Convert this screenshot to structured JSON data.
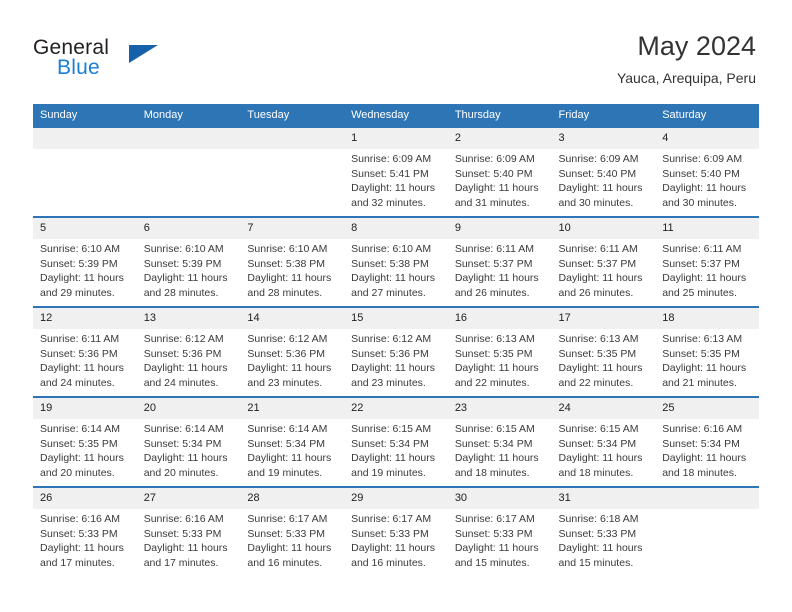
{
  "brand": {
    "word1": "General",
    "word2": "Blue",
    "logo_icon": "triangle-logo-icon",
    "color_primary": "#1562ab",
    "color_secondary": "#1b7fd4"
  },
  "header": {
    "month_title": "May 2024",
    "location": "Yauca, Arequipa, Peru"
  },
  "theme": {
    "header_row_color": "#2e75b6",
    "daynum_band_color": "#f0f0f0",
    "text_color": "#3a3a3a"
  },
  "calendar": {
    "weekday_headers": [
      "Sunday",
      "Monday",
      "Tuesday",
      "Wednesday",
      "Thursday",
      "Friday",
      "Saturday"
    ],
    "weeks": [
      [
        {
          "day": "",
          "sunrise": "",
          "sunset": "",
          "daylight_line1": "",
          "daylight_line2": ""
        },
        {
          "day": "",
          "sunrise": "",
          "sunset": "",
          "daylight_line1": "",
          "daylight_line2": ""
        },
        {
          "day": "",
          "sunrise": "",
          "sunset": "",
          "daylight_line1": "",
          "daylight_line2": ""
        },
        {
          "day": "1",
          "sunrise": "Sunrise: 6:09 AM",
          "sunset": "Sunset: 5:41 PM",
          "daylight_line1": "Daylight: 11 hours",
          "daylight_line2": "and 32 minutes."
        },
        {
          "day": "2",
          "sunrise": "Sunrise: 6:09 AM",
          "sunset": "Sunset: 5:40 PM",
          "daylight_line1": "Daylight: 11 hours",
          "daylight_line2": "and 31 minutes."
        },
        {
          "day": "3",
          "sunrise": "Sunrise: 6:09 AM",
          "sunset": "Sunset: 5:40 PM",
          "daylight_line1": "Daylight: 11 hours",
          "daylight_line2": "and 30 minutes."
        },
        {
          "day": "4",
          "sunrise": "Sunrise: 6:09 AM",
          "sunset": "Sunset: 5:40 PM",
          "daylight_line1": "Daylight: 11 hours",
          "daylight_line2": "and 30 minutes."
        }
      ],
      [
        {
          "day": "5",
          "sunrise": "Sunrise: 6:10 AM",
          "sunset": "Sunset: 5:39 PM",
          "daylight_line1": "Daylight: 11 hours",
          "daylight_line2": "and 29 minutes."
        },
        {
          "day": "6",
          "sunrise": "Sunrise: 6:10 AM",
          "sunset": "Sunset: 5:39 PM",
          "daylight_line1": "Daylight: 11 hours",
          "daylight_line2": "and 28 minutes."
        },
        {
          "day": "7",
          "sunrise": "Sunrise: 6:10 AM",
          "sunset": "Sunset: 5:38 PM",
          "daylight_line1": "Daylight: 11 hours",
          "daylight_line2": "and 28 minutes."
        },
        {
          "day": "8",
          "sunrise": "Sunrise: 6:10 AM",
          "sunset": "Sunset: 5:38 PM",
          "daylight_line1": "Daylight: 11 hours",
          "daylight_line2": "and 27 minutes."
        },
        {
          "day": "9",
          "sunrise": "Sunrise: 6:11 AM",
          "sunset": "Sunset: 5:37 PM",
          "daylight_line1": "Daylight: 11 hours",
          "daylight_line2": "and 26 minutes."
        },
        {
          "day": "10",
          "sunrise": "Sunrise: 6:11 AM",
          "sunset": "Sunset: 5:37 PM",
          "daylight_line1": "Daylight: 11 hours",
          "daylight_line2": "and 26 minutes."
        },
        {
          "day": "11",
          "sunrise": "Sunrise: 6:11 AM",
          "sunset": "Sunset: 5:37 PM",
          "daylight_line1": "Daylight: 11 hours",
          "daylight_line2": "and 25 minutes."
        }
      ],
      [
        {
          "day": "12",
          "sunrise": "Sunrise: 6:11 AM",
          "sunset": "Sunset: 5:36 PM",
          "daylight_line1": "Daylight: 11 hours",
          "daylight_line2": "and 24 minutes."
        },
        {
          "day": "13",
          "sunrise": "Sunrise: 6:12 AM",
          "sunset": "Sunset: 5:36 PM",
          "daylight_line1": "Daylight: 11 hours",
          "daylight_line2": "and 24 minutes."
        },
        {
          "day": "14",
          "sunrise": "Sunrise: 6:12 AM",
          "sunset": "Sunset: 5:36 PM",
          "daylight_line1": "Daylight: 11 hours",
          "daylight_line2": "and 23 minutes."
        },
        {
          "day": "15",
          "sunrise": "Sunrise: 6:12 AM",
          "sunset": "Sunset: 5:36 PM",
          "daylight_line1": "Daylight: 11 hours",
          "daylight_line2": "and 23 minutes."
        },
        {
          "day": "16",
          "sunrise": "Sunrise: 6:13 AM",
          "sunset": "Sunset: 5:35 PM",
          "daylight_line1": "Daylight: 11 hours",
          "daylight_line2": "and 22 minutes."
        },
        {
          "day": "17",
          "sunrise": "Sunrise: 6:13 AM",
          "sunset": "Sunset: 5:35 PM",
          "daylight_line1": "Daylight: 11 hours",
          "daylight_line2": "and 22 minutes."
        },
        {
          "day": "18",
          "sunrise": "Sunrise: 6:13 AM",
          "sunset": "Sunset: 5:35 PM",
          "daylight_line1": "Daylight: 11 hours",
          "daylight_line2": "and 21 minutes."
        }
      ],
      [
        {
          "day": "19",
          "sunrise": "Sunrise: 6:14 AM",
          "sunset": "Sunset: 5:35 PM",
          "daylight_line1": "Daylight: 11 hours",
          "daylight_line2": "and 20 minutes."
        },
        {
          "day": "20",
          "sunrise": "Sunrise: 6:14 AM",
          "sunset": "Sunset: 5:34 PM",
          "daylight_line1": "Daylight: 11 hours",
          "daylight_line2": "and 20 minutes."
        },
        {
          "day": "21",
          "sunrise": "Sunrise: 6:14 AM",
          "sunset": "Sunset: 5:34 PM",
          "daylight_line1": "Daylight: 11 hours",
          "daylight_line2": "and 19 minutes."
        },
        {
          "day": "22",
          "sunrise": "Sunrise: 6:15 AM",
          "sunset": "Sunset: 5:34 PM",
          "daylight_line1": "Daylight: 11 hours",
          "daylight_line2": "and 19 minutes."
        },
        {
          "day": "23",
          "sunrise": "Sunrise: 6:15 AM",
          "sunset": "Sunset: 5:34 PM",
          "daylight_line1": "Daylight: 11 hours",
          "daylight_line2": "and 18 minutes."
        },
        {
          "day": "24",
          "sunrise": "Sunrise: 6:15 AM",
          "sunset": "Sunset: 5:34 PM",
          "daylight_line1": "Daylight: 11 hours",
          "daylight_line2": "and 18 minutes."
        },
        {
          "day": "25",
          "sunrise": "Sunrise: 6:16 AM",
          "sunset": "Sunset: 5:34 PM",
          "daylight_line1": "Daylight: 11 hours",
          "daylight_line2": "and 18 minutes."
        }
      ],
      [
        {
          "day": "26",
          "sunrise": "Sunrise: 6:16 AM",
          "sunset": "Sunset: 5:33 PM",
          "daylight_line1": "Daylight: 11 hours",
          "daylight_line2": "and 17 minutes."
        },
        {
          "day": "27",
          "sunrise": "Sunrise: 6:16 AM",
          "sunset": "Sunset: 5:33 PM",
          "daylight_line1": "Daylight: 11 hours",
          "daylight_line2": "and 17 minutes."
        },
        {
          "day": "28",
          "sunrise": "Sunrise: 6:17 AM",
          "sunset": "Sunset: 5:33 PM",
          "daylight_line1": "Daylight: 11 hours",
          "daylight_line2": "and 16 minutes."
        },
        {
          "day": "29",
          "sunrise": "Sunrise: 6:17 AM",
          "sunset": "Sunset: 5:33 PM",
          "daylight_line1": "Daylight: 11 hours",
          "daylight_line2": "and 16 minutes."
        },
        {
          "day": "30",
          "sunrise": "Sunrise: 6:17 AM",
          "sunset": "Sunset: 5:33 PM",
          "daylight_line1": "Daylight: 11 hours",
          "daylight_line2": "and 15 minutes."
        },
        {
          "day": "31",
          "sunrise": "Sunrise: 6:18 AM",
          "sunset": "Sunset: 5:33 PM",
          "daylight_line1": "Daylight: 11 hours",
          "daylight_line2": "and 15 minutes."
        },
        {
          "day": "",
          "sunrise": "",
          "sunset": "",
          "daylight_line1": "",
          "daylight_line2": ""
        }
      ]
    ]
  }
}
